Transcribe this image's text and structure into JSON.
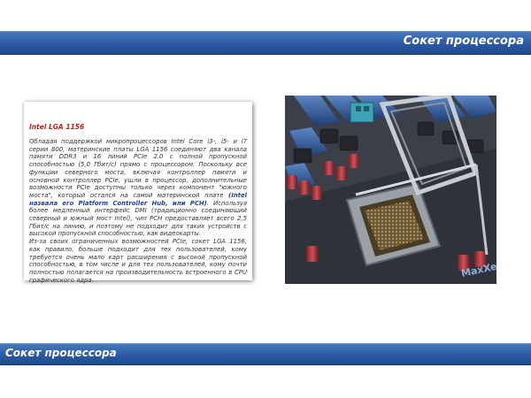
{
  "header": {
    "title": "Сокет процессора"
  },
  "panel": {
    "heading": "Intel LGA 1156",
    "para1_a": "Обладая поддержкой микропроцессоров Intel Core i3-, i5- и i7 серии 800, материнские платы LGA 1156 соединяют два канала памяти DDR3 и 16 линий PCIe 2.0 с полной пропускной способностью (5,0 Гбит/с) прямо с процессором. Поскольку все функции северного моста, включая контроллер памяти и основной контроллер PCIe, ушли в процессор, дополнительные возможности PCIe доступны только через компонент \"южного моста\", который остался на самой материнской плате ",
    "para1_highlight": "(Intel назвала его Platform Controller Hub, или PCH)",
    "para1_b": ". Используя более медленный интерфейс DMI (традиционно соединяющий северный и южный мост Intel), чип PCH предоставляет всего 2,5 Гбит/с на линию, и поэтому не подходит для таких устройств с высокой пропускной способностью, как видеокарты.",
    "para2": "Из-за своих ограниченных возможностей PCIe, сокет LGA 1156, как правило, больше подходит для тех пользователей, кому требуется очень мало карт расширения с высокой пропускной способностью, в том числе и для тех пользователей, кому почти полностью полагается на производительность встроенного в CPU графического ядра."
  },
  "footer": {
    "title": "Сокет процессора"
  },
  "colors": {
    "bar": "#2c5aa3",
    "heading": "#b3261e",
    "highlight": "#1f3f9a"
  }
}
